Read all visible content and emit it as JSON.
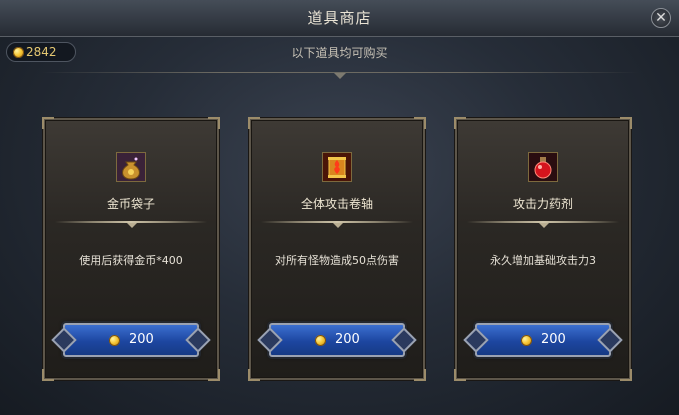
{
  "window": {
    "title": "道具商店",
    "close_icon": "close-icon"
  },
  "currency": {
    "icon": "gold-coin-icon",
    "amount": "2842"
  },
  "subtitle": "以下道具均可购买",
  "items": [
    {
      "name": "金币袋子",
      "icon": "coin-bag-icon",
      "description": "使用后获得金币*400",
      "price": "200",
      "price_icon": "gold-coin-icon"
    },
    {
      "name": "全体攻击卷轴",
      "icon": "fire-scroll-icon",
      "description": "对所有怪物造成50点伤害",
      "price": "200",
      "price_icon": "gold-coin-icon"
    },
    {
      "name": "攻击力药剂",
      "icon": "red-potion-icon",
      "description": "永久增加基础攻击力3",
      "price": "200",
      "price_icon": "gold-coin-icon"
    }
  ],
  "colors": {
    "accent_gold": "#e5c872",
    "button_blue": "#1d46a0",
    "panel_bg": "#262d38"
  }
}
